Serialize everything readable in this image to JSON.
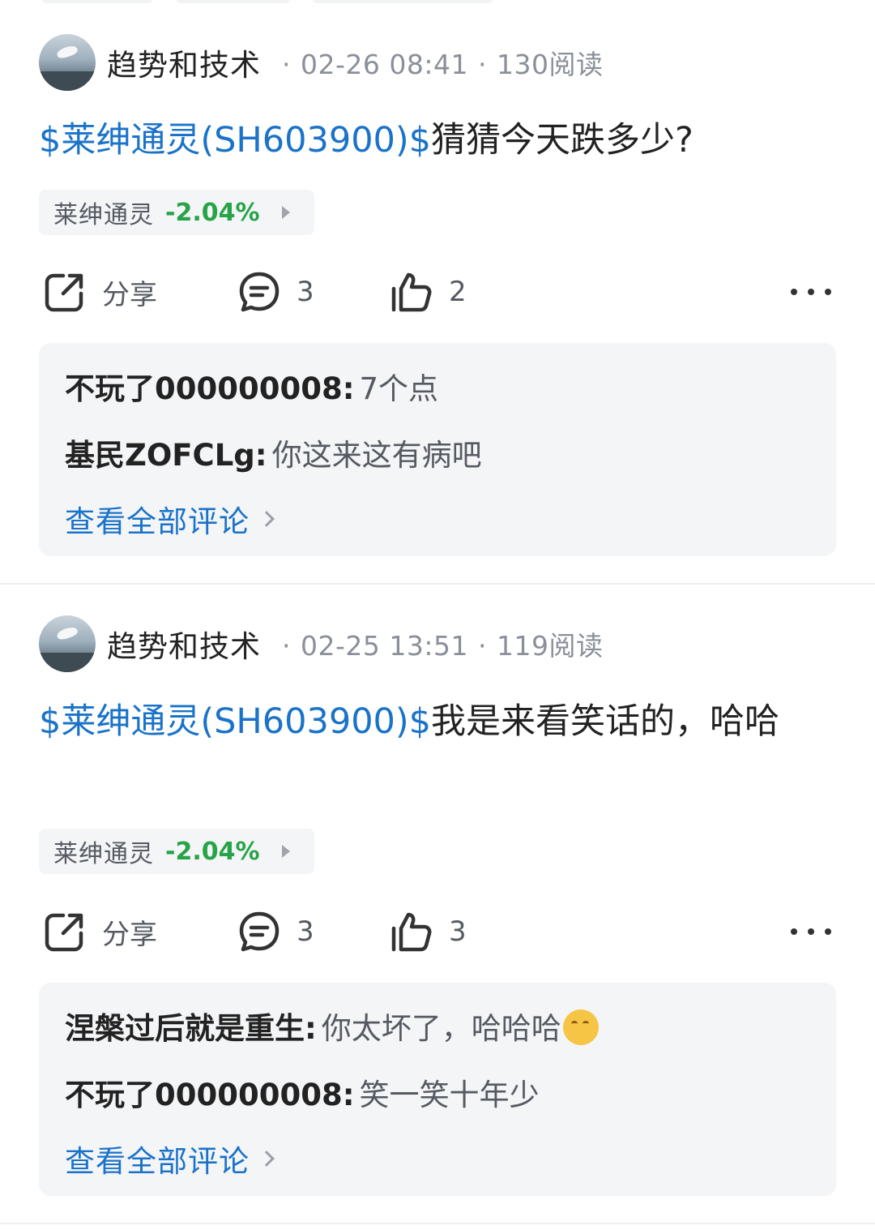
{
  "colors": {
    "link": "#1a73c9",
    "down_change": "#27a348",
    "muted": "#8a8f99",
    "card_bg": "#f4f5f7"
  },
  "posts": [
    {
      "author": "趋势和技术",
      "date": "02-26 08:41",
      "reads": "130阅读",
      "stock_link": "$莱绅通灵(SH603900)$",
      "text": "猜猜今天跌多少?",
      "stock_tag": {
        "name": "莱绅通灵",
        "change": "-2.04%"
      },
      "actions": {
        "share": "分享",
        "comments": "3",
        "likes": "2"
      },
      "comments": [
        {
          "user": "不玩了000000008",
          "text": "7个点"
        },
        {
          "user": "基民ZOFCLg",
          "text": "你这来这有病吧"
        }
      ],
      "view_all": "查看全部评论"
    },
    {
      "author": "趋势和技术",
      "date": "02-25 13:51",
      "reads": "119阅读",
      "stock_link": "$莱绅通灵(SH603900)$",
      "text": "我是来看笑话的，哈哈",
      "stock_tag": {
        "name": "莱绅通灵",
        "change": "-2.04%"
      },
      "actions": {
        "share": "分享",
        "comments": "3",
        "likes": "3"
      },
      "comments": [
        {
          "user": "涅槃过后就是重生",
          "text": "你太坏了，哈哈哈",
          "emoji": "smirking-face"
        },
        {
          "user": "不玩了000000008",
          "text": "笑一笑十年少"
        }
      ],
      "view_all": "查看全部评论"
    }
  ]
}
